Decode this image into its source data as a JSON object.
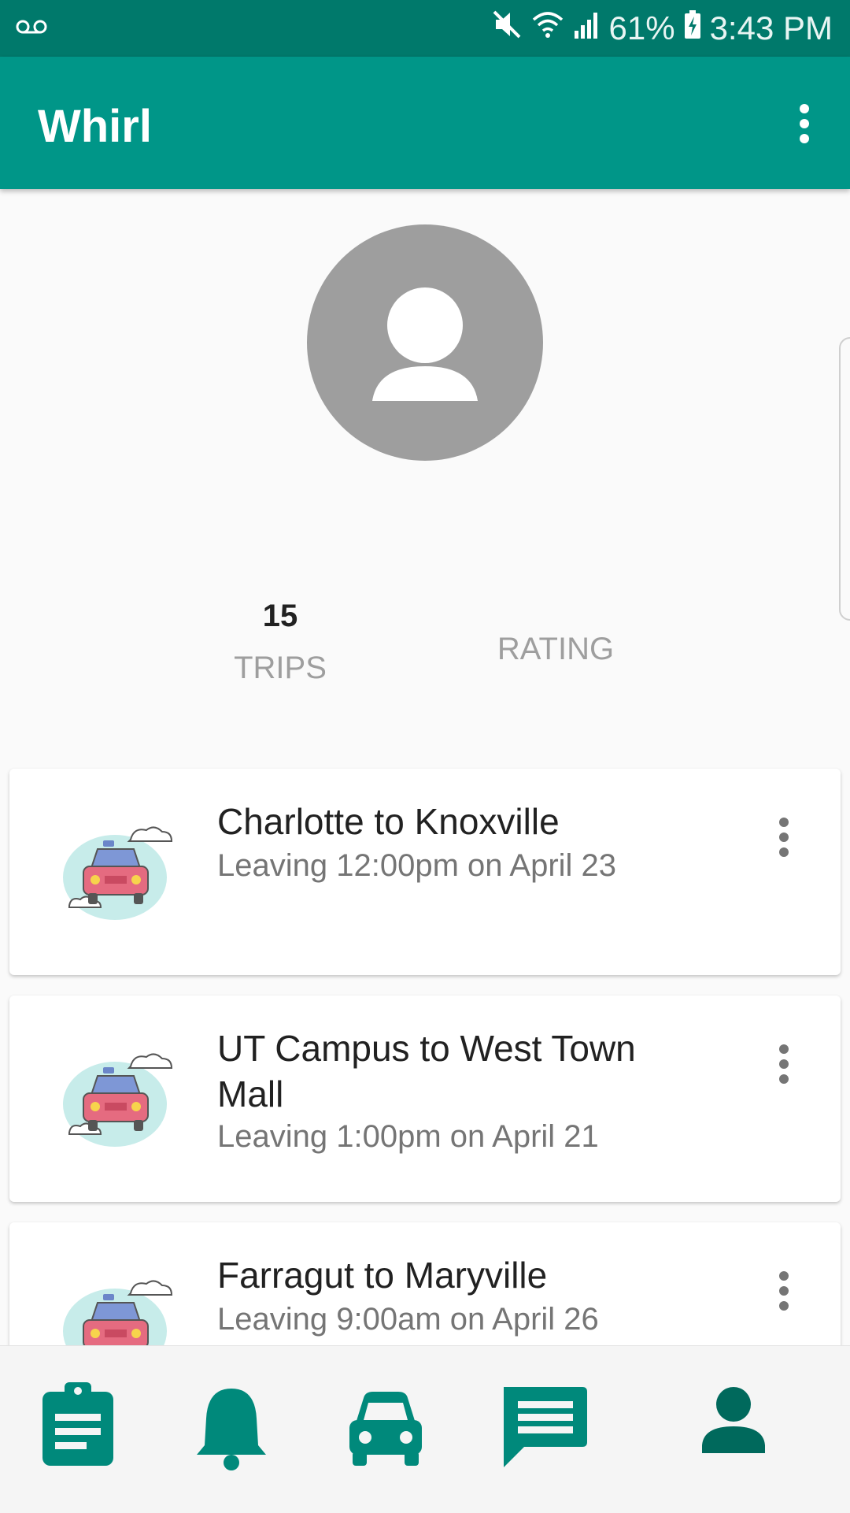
{
  "status_bar": {
    "battery": "61%",
    "time": "3:43 PM",
    "icons": [
      "voicemail-icon",
      "mute-icon",
      "wifi-icon",
      "signal-icon",
      "battery-charging-icon"
    ]
  },
  "app_bar": {
    "title": "Whirl",
    "overflow_icon": "more-vert-icon"
  },
  "profile": {
    "avatar_icon": "person-icon",
    "stats": {
      "trips_value": "15",
      "trips_label": "TRIPS",
      "rating_label": "RATING"
    }
  },
  "trips": [
    {
      "title": "Charlotte to Knoxville",
      "subtitle": "Leaving 12:00pm on April 23",
      "thumbnail": "car-icon",
      "menu_icon": "more-vert-icon"
    },
    {
      "title": "UT Campus to West Town Mall",
      "subtitle": "Leaving 1:00pm on April 21",
      "thumbnail": "car-icon",
      "menu_icon": "more-vert-icon"
    },
    {
      "title": "Farragut to Maryville",
      "subtitle": "Leaving 9:00am on April 26",
      "thumbnail": "car-icon",
      "menu_icon": "more-vert-icon"
    }
  ],
  "bottom_nav": {
    "items": [
      {
        "icon": "clipboard-icon"
      },
      {
        "icon": "bell-icon"
      },
      {
        "icon": "car-icon"
      },
      {
        "icon": "chat-icon"
      },
      {
        "icon": "person-icon",
        "active": true
      }
    ]
  },
  "colors": {
    "status_bar": "#00796b",
    "app_bar": "#009688",
    "nav_icon": "#00897b",
    "nav_icon_active": "#00695c",
    "avatar": "#9e9e9e",
    "background": "#fafafa"
  }
}
